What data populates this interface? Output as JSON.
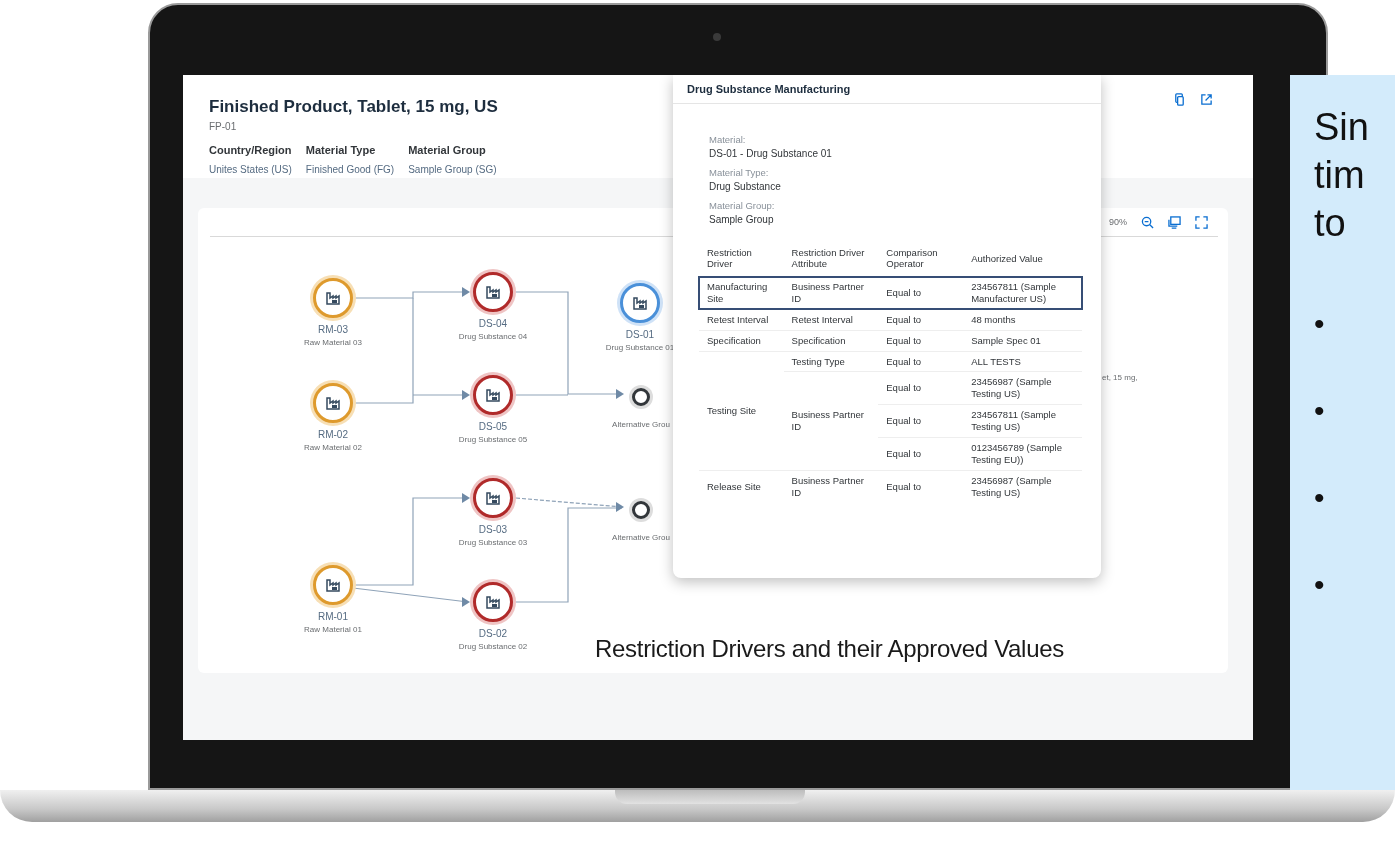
{
  "header": {
    "title": "Finished Product, Tablet, 15 mg, US",
    "subtitle": "FP-01",
    "attributes": [
      {
        "label": "Country/Region",
        "value": "Unites States (US)"
      },
      {
        "label": "Material Type",
        "value": "Finished Good (FG)"
      },
      {
        "label": "Material Group",
        "value": "Sample Group (SG)"
      }
    ]
  },
  "toolbar": {
    "zoom": "90%"
  },
  "graph": {
    "nodes": [
      {
        "kind": "raw",
        "id": "RM-03",
        "name": "Raw Material 03",
        "selected": false
      },
      {
        "kind": "substance",
        "id": "DS-04",
        "name": "Drug Substance 04",
        "selected": false
      },
      {
        "kind": "substance",
        "id": "DS-01",
        "name": "Drug Substance 01",
        "selected": true
      },
      {
        "kind": "raw",
        "id": "RM-02",
        "name": "Raw Material 02",
        "selected": false
      },
      {
        "kind": "substance",
        "id": "DS-05",
        "name": "Drug Substance 05",
        "selected": false
      },
      {
        "kind": "group",
        "name": "Alternative Grou",
        "selected": false
      },
      {
        "kind": "substance",
        "id": "DS-03",
        "name": "Drug Substance 03",
        "selected": false
      },
      {
        "kind": "group",
        "name": "Alternative Grou",
        "selected": false
      },
      {
        "kind": "raw",
        "id": "RM-01",
        "name": "Raw Material 01",
        "selected": false
      },
      {
        "kind": "substance",
        "id": "DS-02",
        "name": "Drug Substance 02",
        "selected": false
      }
    ],
    "partial_label": "et, 15 mg,"
  },
  "popover": {
    "title": "Drug Substance Manufacturing",
    "fields": [
      {
        "label": "Material:",
        "value": "DS-01 - Drug Substance 01"
      },
      {
        "label": "Material Type:",
        "value": "Drug Substance"
      },
      {
        "label": "Material Group:",
        "value": "Sample Group"
      }
    ],
    "columns": [
      "Restriction Driver",
      "Restriction Driver Attribute",
      "Comparison Operator",
      "Authorized Value"
    ],
    "restrictions": [
      {
        "driver": "Manufacturing Site",
        "selected": true,
        "attributes": [
          {
            "attribute": "Business Partner ID",
            "values": [
              {
                "operator": "Equal to",
                "value": "234567811 (Sample Manufacturer US)"
              }
            ]
          }
        ]
      },
      {
        "driver": "Retest Interval",
        "selected": false,
        "attributes": [
          {
            "attribute": "Retest Interval",
            "values": [
              {
                "operator": "Equal to",
                "value": "48 months"
              }
            ]
          }
        ]
      },
      {
        "driver": "Specification",
        "selected": false,
        "attributes": [
          {
            "attribute": "Specification",
            "values": [
              {
                "operator": "Equal to",
                "value": "Sample Spec 01"
              }
            ]
          }
        ]
      },
      {
        "driver": "Testing Site",
        "selected": false,
        "attributes": [
          {
            "attribute": "Testing Type",
            "values": [
              {
                "operator": "Equal to",
                "value": "ALL TESTS"
              }
            ]
          },
          {
            "attribute": "Business Partner ID",
            "values": [
              {
                "operator": "Equal to",
                "value": "23456987 (Sample Testing US)"
              },
              {
                "operator": "Equal to",
                "value": "234567811 (Sample Testing US)"
              },
              {
                "operator": "Equal to",
                "value": "0123456789 (Sample Testing EU))"
              }
            ]
          }
        ]
      },
      {
        "driver": "Release Site",
        "selected": false,
        "attributes": [
          {
            "attribute": "Business Partner ID",
            "values": [
              {
                "operator": "Equal to",
                "value": "23456987 (Sample Testing US)"
              }
            ]
          }
        ]
      }
    ]
  },
  "caption": "Restriction Drivers and their Approved Values",
  "side_panel": {
    "lines": [
      "Sin",
      "tim",
      "to"
    ],
    "bullets": [
      "•",
      "•",
      "•",
      "•"
    ]
  }
}
